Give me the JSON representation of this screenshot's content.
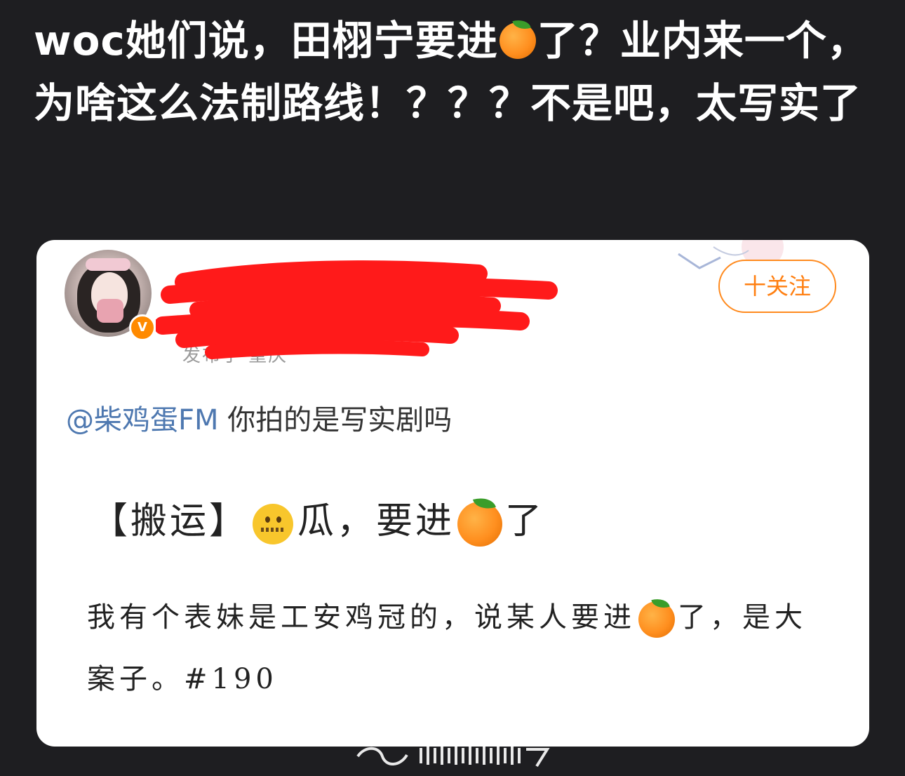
{
  "headline": "woc她们说，田栩宁要进🍊了？业内来一个，为啥这么法制路线！？？？不是吧，太写实了",
  "headline_parts": {
    "before_emoji": "woc她们说，田栩宁要进",
    "after_emoji": "了？业内来一个，为啥这么法制路线！？？？不是吧，太写实了"
  },
  "card": {
    "avatar_badge": "V",
    "follow_button": "十关注",
    "post_meta": "发布于 重庆",
    "reply": {
      "mention": "@柴鸡蛋FM",
      "text": " 你拍的是写实剧吗"
    },
    "image_text_line1": {
      "prefix": "【搬运】",
      "middle": "瓜，要进",
      "suffix": "了"
    },
    "image_text_line2": {
      "part1": "我有个表妹是工安鸡冠的，说某人要进",
      "part2": "了，是大案子。#190"
    }
  },
  "icons": [
    "orange-emoji",
    "zipper-mouth-emoji",
    "verified-badge"
  ],
  "colors": {
    "background": "#1e1e21",
    "follow_orange": "#ff7f11",
    "mention_blue": "#4e78b0",
    "redaction_red": "#ff1a1a",
    "badge_orange": "#ff8a00"
  }
}
